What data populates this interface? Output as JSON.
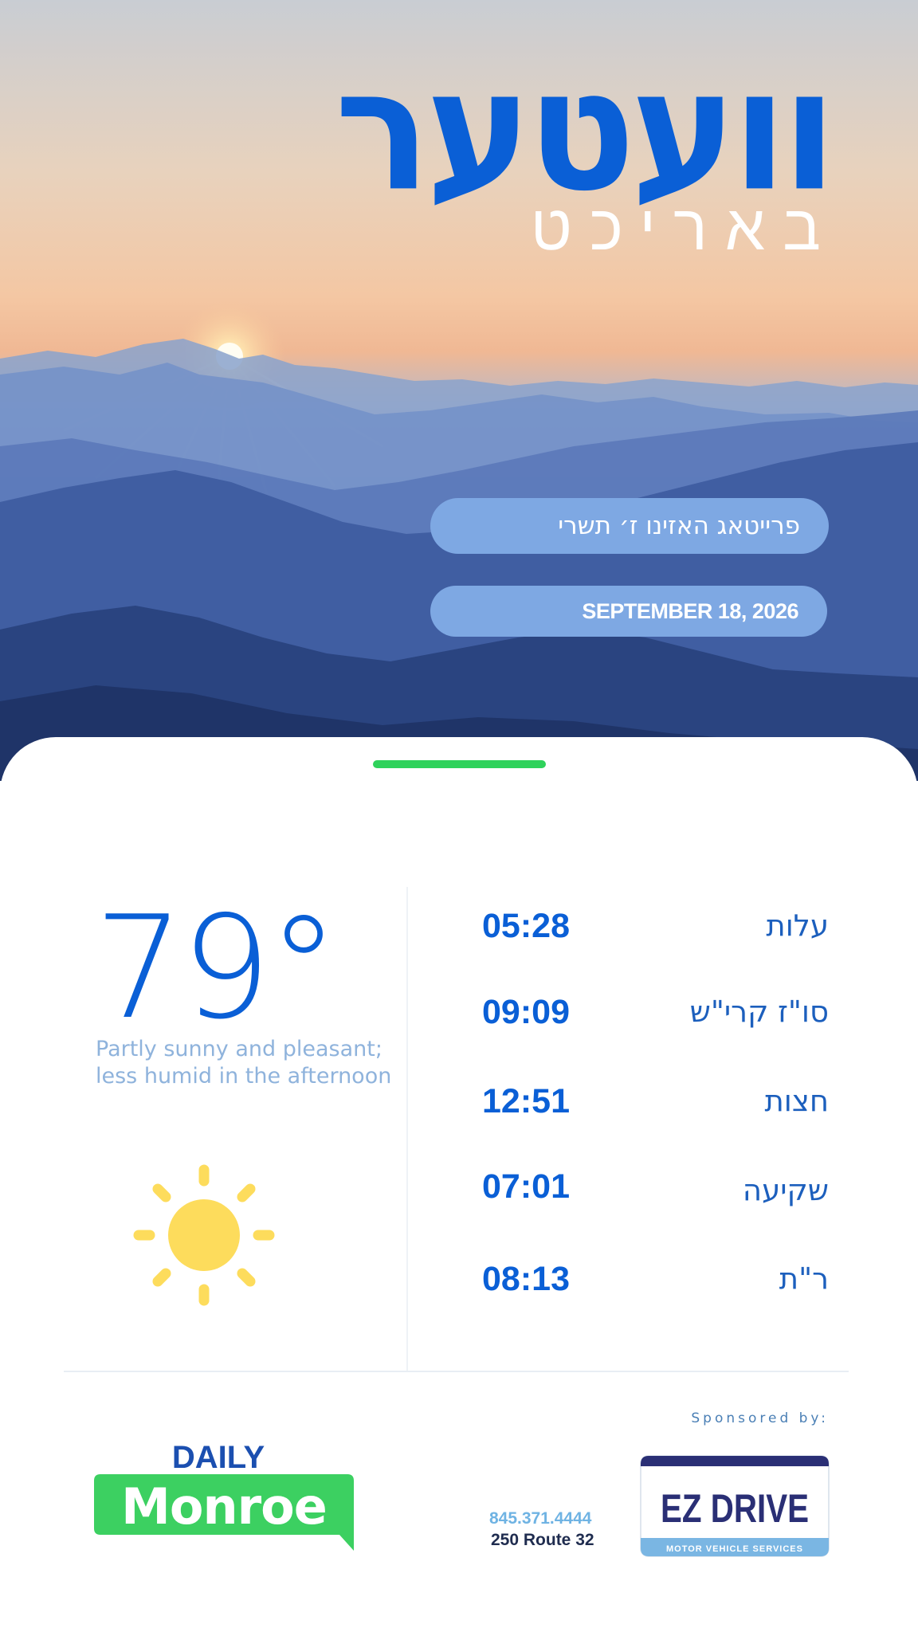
{
  "header": {
    "title": "וועטער",
    "subtitle": "באריכט",
    "hebrew_date": "פרייטאג האזינו ז׳ תשרי",
    "gregorian_date": "SEPTEMBER 18, 2026"
  },
  "weather": {
    "temperature": "79°",
    "description": "Partly sunny and pleasant; less humid in the afternoon",
    "icon": "sun-icon"
  },
  "zmanim": [
    {
      "label": "עלות",
      "time": "05:28"
    },
    {
      "label": "סו\"ז קרי\"ש",
      "time": "09:09"
    },
    {
      "label": "חצות",
      "time": "12:51"
    },
    {
      "label": "שקיעה",
      "time": "07:01"
    },
    {
      "label": "ר\"ת",
      "time": "08:13"
    }
  ],
  "footer": {
    "logo_daily": "DAILY",
    "logo_monroe": "Monroe",
    "sponsored_by": "Sponsored by:",
    "sponsor_phone": "845.371.4444",
    "sponsor_address": "250 Route 32",
    "sponsor_name": "EZ DRIVE",
    "sponsor_tagline": "MOTOR VEHICLE SERVICES"
  },
  "colors": {
    "accent_blue": "#0a5fd6",
    "pill_blue": "#7ea8e3",
    "handle_green": "#2fd25b",
    "sun_yellow": "#fddc5c",
    "monroe_green": "#3cd061"
  }
}
